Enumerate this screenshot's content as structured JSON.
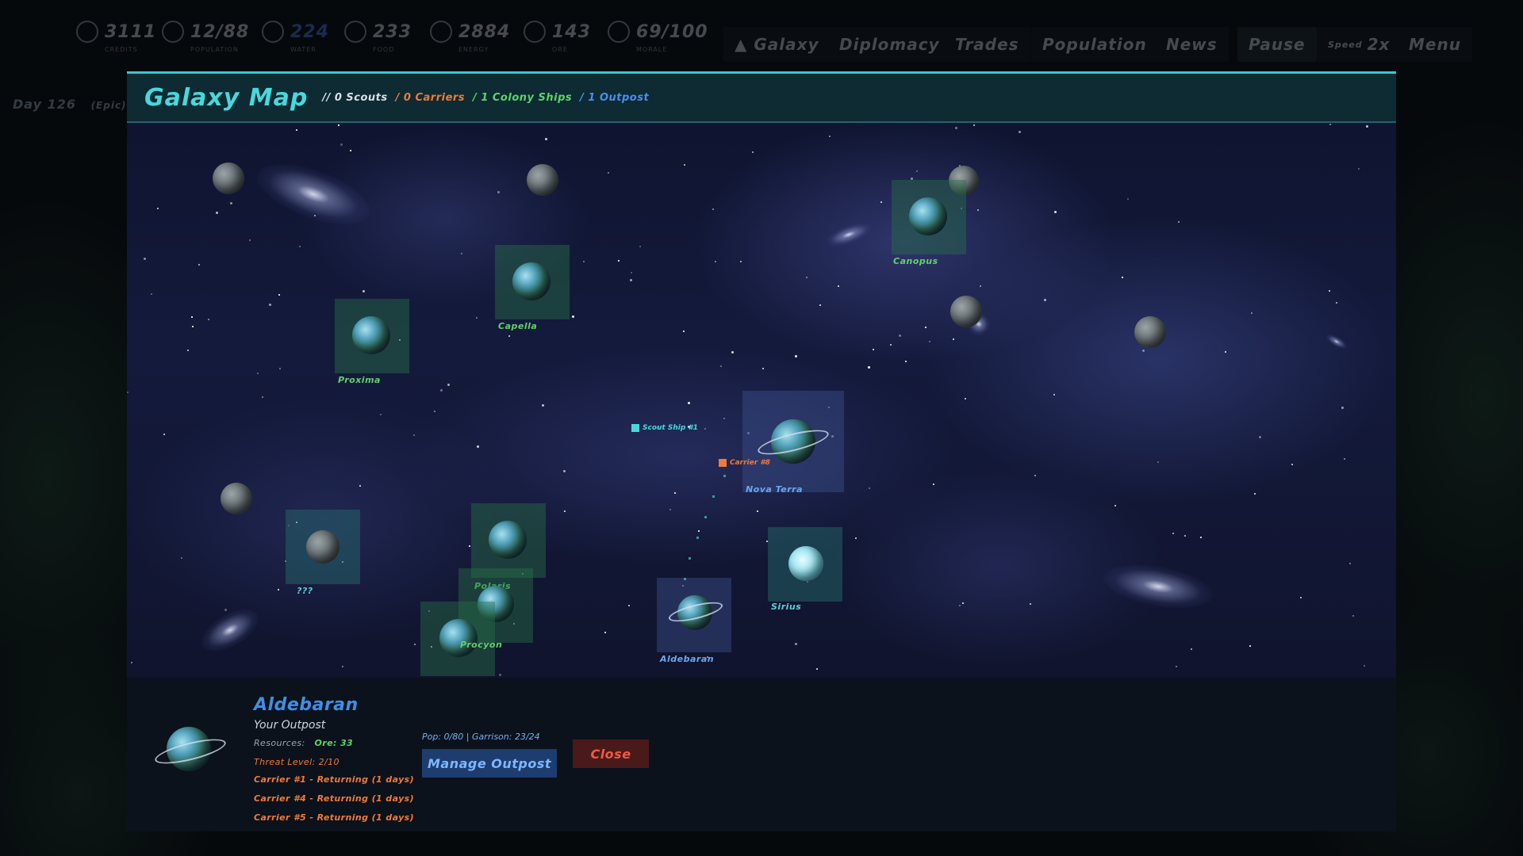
{
  "hud": {
    "resources": [
      {
        "value": "3111",
        "label": "Credits",
        "icon": "coin-icon"
      },
      {
        "value": "12/88",
        "label": "Population",
        "icon": "people-icon"
      },
      {
        "value": "224",
        "label": "Water",
        "icon": "water-icon"
      },
      {
        "value": "233",
        "label": "Food",
        "icon": "food-icon"
      },
      {
        "value": "2884",
        "label": "Energy",
        "icon": "energy-icon"
      },
      {
        "value": "143",
        "label": "Ore",
        "icon": "pickaxe-icon"
      },
      {
        "value": "69/100",
        "label": "Morale",
        "icon": "morale-icon"
      }
    ],
    "nav": [
      "Galaxy",
      "Diplomacy",
      "Trades",
      "Population",
      "News"
    ],
    "pause": "Pause",
    "speed_label": "Speed",
    "speed_value": "2x",
    "menu": "Menu",
    "day": "Day 126",
    "day_extra": "(Epic)"
  },
  "panel": {
    "title": "Galaxy Map",
    "fleet": {
      "scouts": "// 0 Scouts",
      "carriers": "/ 0 Carriers",
      "colony": "/ 1 Colony Ships",
      "outpost": "/ 1 Outpost"
    },
    "colors": {
      "scouts": "#d8e0e8",
      "carriers": "#ef7a3a",
      "colony": "#5ed36a",
      "outpost": "#4a8ef0"
    }
  },
  "map": {
    "nodes": [
      {
        "name": "Proxima",
        "color": "#5ed36a"
      },
      {
        "name": "Capella",
        "color": "#5ed36a"
      },
      {
        "name": "Canopus",
        "color": "#5ed36a"
      },
      {
        "name": "Nova Terra",
        "color": "#6aa8f0"
      },
      {
        "name": "???",
        "color": "#5ecfd3"
      },
      {
        "name": "Polaris",
        "color": "#5ed36a"
      },
      {
        "name": "Procyon",
        "color": "#5ed36a"
      },
      {
        "name": "Aldebaran",
        "color": "#6aa8f0"
      },
      {
        "name": "Sirius",
        "color": "#5ecfd3"
      }
    ],
    "ships": {
      "scout": "Scout Ship #1",
      "carrier": "Carrier #8"
    }
  },
  "detail": {
    "name": "Aldebaran",
    "subtitle": "Your Outpost",
    "resources_label": "Resources:",
    "resources_value": "Ore: 33",
    "threat": "Threat Level: 2/10",
    "carriers": [
      "Carrier #1 - Returning (1 days)",
      "Carrier #4 - Returning (1 days)",
      "Carrier #5 - Returning (1 days)"
    ],
    "pop_garrison": "Pop: 0/80 | Garrison: 23/24",
    "manage_button": "Manage Outpost",
    "close_button": "Close"
  }
}
